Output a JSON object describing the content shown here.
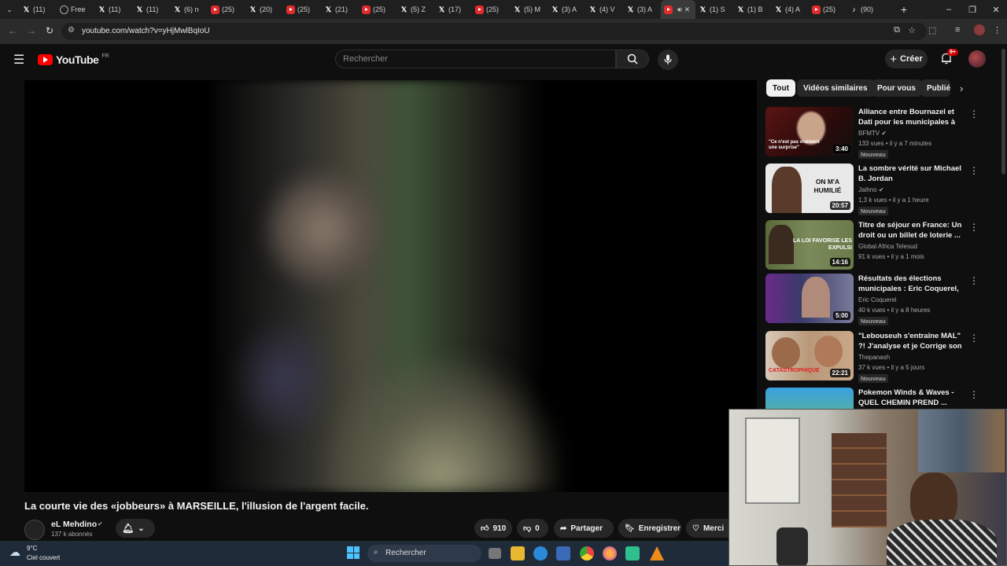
{
  "browser": {
    "tabs": [
      {
        "label": "(11)",
        "icon": "x-logo-icon"
      },
      {
        "label": "Free",
        "icon": "circle-icon"
      },
      {
        "label": "(11)",
        "icon": "x-logo-icon"
      },
      {
        "label": "(11)",
        "icon": "x-logo-icon"
      },
      {
        "label": "(6) n",
        "icon": "x-logo-icon"
      },
      {
        "label": "(25)",
        "icon": "youtube-icon"
      },
      {
        "label": "(20)",
        "icon": "x-logo-icon"
      },
      {
        "label": "(25)",
        "icon": "youtube-icon"
      },
      {
        "label": "(21)",
        "icon": "x-logo-icon"
      },
      {
        "label": "(25)",
        "icon": "youtube-icon"
      },
      {
        "label": "(5) Z",
        "icon": "x-logo-icon"
      },
      {
        "label": "(17)",
        "icon": "x-logo-icon"
      },
      {
        "label": "(25)",
        "icon": "youtube-icon"
      },
      {
        "label": "(5) M",
        "icon": "x-logo-icon"
      },
      {
        "label": "(3) A",
        "icon": "x-logo-icon"
      },
      {
        "label": "(4) V",
        "icon": "x-logo-icon"
      },
      {
        "label": "(3) A",
        "icon": "x-logo-icon"
      },
      {
        "label": "",
        "icon": "youtube-icon",
        "active": true
      },
      {
        "label": "(1) S",
        "icon": "x-logo-icon"
      },
      {
        "label": "(1) B",
        "icon": "x-logo-icon"
      },
      {
        "label": "(4) A",
        "icon": "x-logo-icon"
      },
      {
        "label": "(25)",
        "icon": "youtube-icon"
      },
      {
        "label": "(90)",
        "icon": "tiktok-icon"
      }
    ],
    "url": "youtube.com/watch?v=yHjMwlBqIoU"
  },
  "youtube": {
    "logo_text": "YouTube",
    "region": "FR",
    "search_placeholder": "Rechercher",
    "create_label": "Créer",
    "notif_badge": "9+",
    "video_title": "La courte vie des «jobbeurs» à MARSEILLE, l'illusion de l'argent facile.",
    "channel_name": "eL Mehdino",
    "subscribers": "137 k abonnés",
    "likes": "910",
    "dislikes": "0",
    "share_label": "Partager",
    "save_label": "Enregistrer",
    "thanks_label": "Merci",
    "chips": [
      "Tout",
      "Vidéos similaires",
      "Pour vous",
      "Publié"
    ],
    "recommendations": [
      {
        "title": "Alliance entre Bournazel et Dati pour les municipales à Paris: l...",
        "channel": "BFMTV",
        "verified": true,
        "meta": "133 vues • il y a 7 minutes",
        "badge": "Nouveau",
        "duration": "3:40",
        "thumb_text": "\"Ce n'est pas vraiment une surprise\""
      },
      {
        "title": "La sombre vérité sur Michael B. Jordan",
        "channel": "Jaihno",
        "verified": true,
        "meta": "1,3 k vues • il y a 1 heure",
        "badge": "Nouveau",
        "duration": "20:57",
        "thumb_text": "ON M'A HUMILIÉ"
      },
      {
        "title": "Titre de séjour en France: Un droit ou un billet de loterie ...",
        "channel": "Global Africa Telesud",
        "verified": false,
        "meta": "91 k vues • il y a 1 mois",
        "badge": "",
        "duration": "14:16",
        "thumb_text": "LA LOI FAVORISE LES EXPULSI"
      },
      {
        "title": "Résultats des élections municipales : Eric Coquerel, ...",
        "channel": "Eric Coquerel",
        "verified": false,
        "meta": "40 k vues • il y a 8 heures",
        "badge": "Nouveau",
        "duration": "5:00",
        "thumb_text": ""
      },
      {
        "title": "\"Lebouseuh s'entraîne MAL\" ?! J'analyse et je Corrige son ...",
        "channel": "Thepanash",
        "verified": false,
        "meta": "37 k vues • il y a 5 jours",
        "badge": "Nouveau",
        "duration": "22:21",
        "thumb_text": "CATASTROPHIQUE"
      },
      {
        "title": "Pokemon Winds & Waves - QUEL CHEMIN PREND ...",
        "channel": "",
        "verified": false,
        "meta": "",
        "badge": "",
        "duration": "",
        "thumb_text": ""
      }
    ]
  },
  "taskbar": {
    "temp": "9°C",
    "weather": "Ciel couvert",
    "search_label": "Rechercher"
  }
}
